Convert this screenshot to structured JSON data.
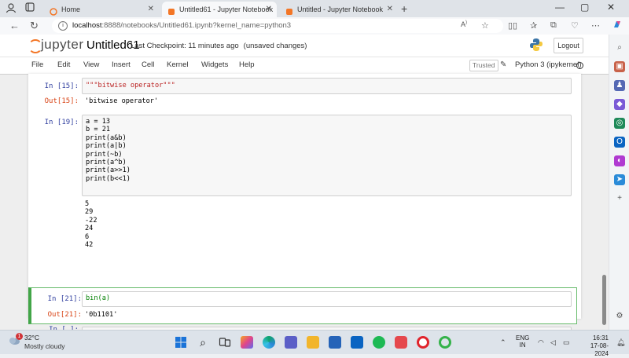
{
  "browser": {
    "tabs": [
      {
        "label": "Home",
        "active": false
      },
      {
        "label": "Untitled61 - Jupyter Notebook",
        "active": true
      },
      {
        "label": "Untitled - Jupyter Notebook",
        "active": false
      }
    ],
    "url_host": "localhost",
    "url_rest": ":8888/notebooks/Untitled61.ipynb?kernel_name=python3"
  },
  "jupyter": {
    "logo_text": "jupyter",
    "notebook_name": "Untitled61",
    "checkpoint": "Last Checkpoint: 11 minutes ago",
    "unsaved": "(unsaved changes)",
    "logout_label": "Logout",
    "menu": [
      "File",
      "Edit",
      "View",
      "Insert",
      "Cell",
      "Kernel",
      "Widgets",
      "Help"
    ],
    "trusted": "Trusted",
    "kernel": "Python 3 (ipykernel)"
  },
  "cells": {
    "c15": {
      "in_prompt": "In [15]:",
      "code": "\"\"\"bitwise operator\"\"\"",
      "out_prompt": "Out[15]:",
      "output": "'bitwise operator'"
    },
    "c19": {
      "in_prompt": "In [19]:",
      "lines": [
        "a = 13",
        "b = 21",
        "print(a&b)",
        "print(a|b)",
        "print(~b)",
        "print(a^b)",
        "print(a>>1)",
        "print(b<<1)"
      ],
      "output": [
        "5",
        "29",
        "-22",
        "24",
        "6",
        "42"
      ]
    },
    "c21": {
      "in_prompt": "In [21]:",
      "code": "bin(a)",
      "out_prompt": "Out[21]:",
      "output": "'0b1101'"
    },
    "empty": {
      "in_prompt": "In [ ]:"
    }
  },
  "taskbar": {
    "temperature": "32°C",
    "condition": "Mostly cloudy",
    "weather_badge": "1",
    "lang_line1": "ENG",
    "lang_line2": "IN",
    "time": "16:31",
    "date": "17-08-2024"
  },
  "colors": {
    "accent_orange": "#f37626",
    "selected_cell": "#42a548",
    "prompt_in": "#303f9f",
    "prompt_out": "#d84315"
  }
}
